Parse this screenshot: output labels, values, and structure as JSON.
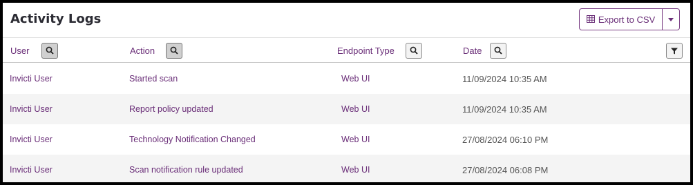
{
  "page": {
    "title": "Activity Logs",
    "export_label": "Export to CSV"
  },
  "columns": {
    "user": "User",
    "action": "Action",
    "endpoint_type": "Endpoint Type",
    "date": "Date"
  },
  "icons": {
    "export": "table-icon",
    "search": "search-icon",
    "filter": "filter-icon",
    "dropdown": "chevron-down-icon"
  },
  "colors": {
    "accent": "#6a2e78",
    "alt_row": "#f4f4f4"
  },
  "rows": [
    {
      "user": "Invicti User",
      "action": "Started scan",
      "endpoint_type": "Web UI",
      "date": "11/09/2024 10:35 AM"
    },
    {
      "user": "Invicti User",
      "action": "Report policy updated",
      "endpoint_type": "Web UI",
      "date": "11/09/2024 10:35 AM"
    },
    {
      "user": "Invicti User",
      "action": "Technology Notification Changed",
      "endpoint_type": "Web UI",
      "date": "27/08/2024 06:10 PM"
    },
    {
      "user": "Invicti User",
      "action": "Scan notification rule updated",
      "endpoint_type": "Web UI",
      "date": "27/08/2024 06:08 PM"
    }
  ]
}
